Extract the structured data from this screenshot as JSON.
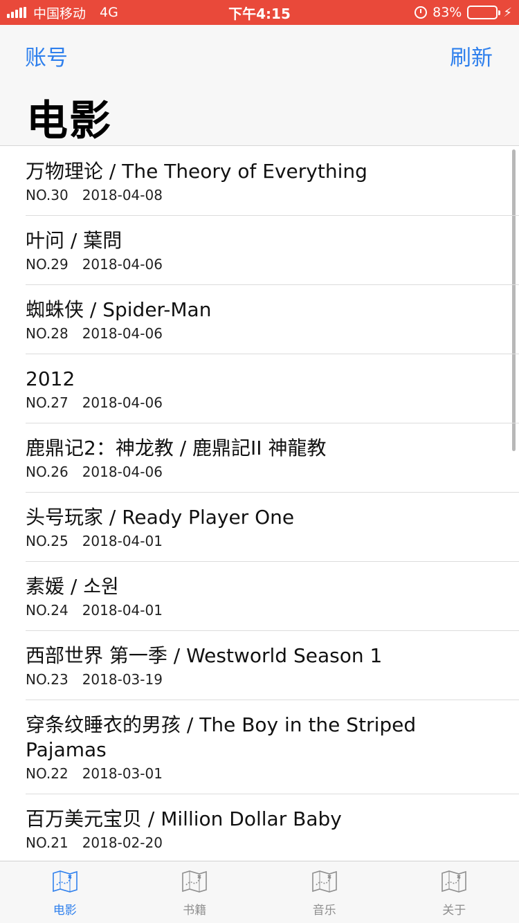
{
  "status_bar": {
    "carrier": "中国移动",
    "network": "4G",
    "time": "下午4:15",
    "battery": "83%",
    "battery_level": 0.83
  },
  "nav": {
    "left_label": "账号",
    "right_label": "刷新",
    "title": "电影"
  },
  "movies": [
    {
      "title": "万物理论 / The Theory of Everything",
      "no": "NO.30",
      "date": "2018-04-08"
    },
    {
      "title": "叶问 / 葉問",
      "no": "NO.29",
      "date": "2018-04-06"
    },
    {
      "title": "蜘蛛侠 / Spider-Man",
      "no": "NO.28",
      "date": "2018-04-06"
    },
    {
      "title": "2012",
      "no": "NO.27",
      "date": "2018-04-06"
    },
    {
      "title": "鹿鼎记2：神龙教 / 鹿鼎記II 神龍教",
      "no": "NO.26",
      "date": "2018-04-06"
    },
    {
      "title": "头号玩家 / Ready Player One",
      "no": "NO.25",
      "date": "2018-04-01"
    },
    {
      "title": "素媛 / 소원",
      "no": "NO.24",
      "date": "2018-04-01"
    },
    {
      "title": "西部世界 第一季 / Westworld Season 1",
      "no": "NO.23",
      "date": "2018-03-19"
    },
    {
      "title": "穿条纹睡衣的男孩 / The Boy in the Striped Pajamas",
      "no": "NO.22",
      "date": "2018-03-01"
    },
    {
      "title": "百万美元宝贝 / Million Dollar Baby",
      "no": "NO.21",
      "date": "2018-02-20"
    }
  ],
  "tabs": [
    {
      "label": "电影",
      "icon": "map-icon",
      "active": true
    },
    {
      "label": "书籍",
      "icon": "map-icon",
      "active": false
    },
    {
      "label": "音乐",
      "icon": "map-icon",
      "active": false
    },
    {
      "label": "关于",
      "icon": "map-icon",
      "active": false
    }
  ],
  "colors": {
    "status_bar": "#e9493a",
    "accent": "#2f80ed",
    "inactive_tab": "#8e8e8e"
  }
}
